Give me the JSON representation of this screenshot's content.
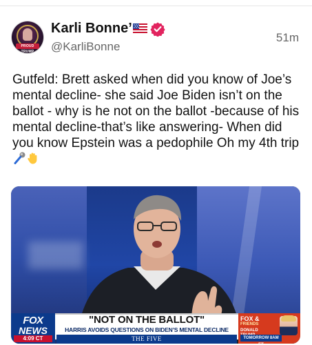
{
  "post": {
    "author_name": "Karli Bonne’",
    "handle": "@KarliBonne",
    "time_ago": "51m",
    "avatar_text": "PROUD TRUMP",
    "body": "Gutfeld: Brett asked when did you know of Joe’s mental decline- she said Joe Biden isn’t on the ballot - why is he not on the ballot -because of his mental decline-that’s like answering- When did you know Epstein was a pedophile Oh my 4th trip ",
    "emojis": [
      "microphone-icon",
      "raised-hand-icon"
    ]
  },
  "media": {
    "network_logo_line1": "FOX",
    "network_logo_line2": "NEWS",
    "time_label": "4:09 CT",
    "chyron_headline": "\"NOT ON THE BALLOT\"",
    "chyron_subhead": "HARRIS AVOIDS QUESTIONS ON BIDEN’S MENTAL DECLINE",
    "show_name": "THE FIVE",
    "promo_brand": "FOX &",
    "promo_brand2": "FRIENDS",
    "promo_guest": "DONALD TRUMP",
    "promo_schedule": "TOMORROW 8AM ET"
  },
  "colors": {
    "verified_badge": "#e2245f",
    "fox_blue": "#0b3a8c",
    "fox_red": "#c8102e"
  }
}
